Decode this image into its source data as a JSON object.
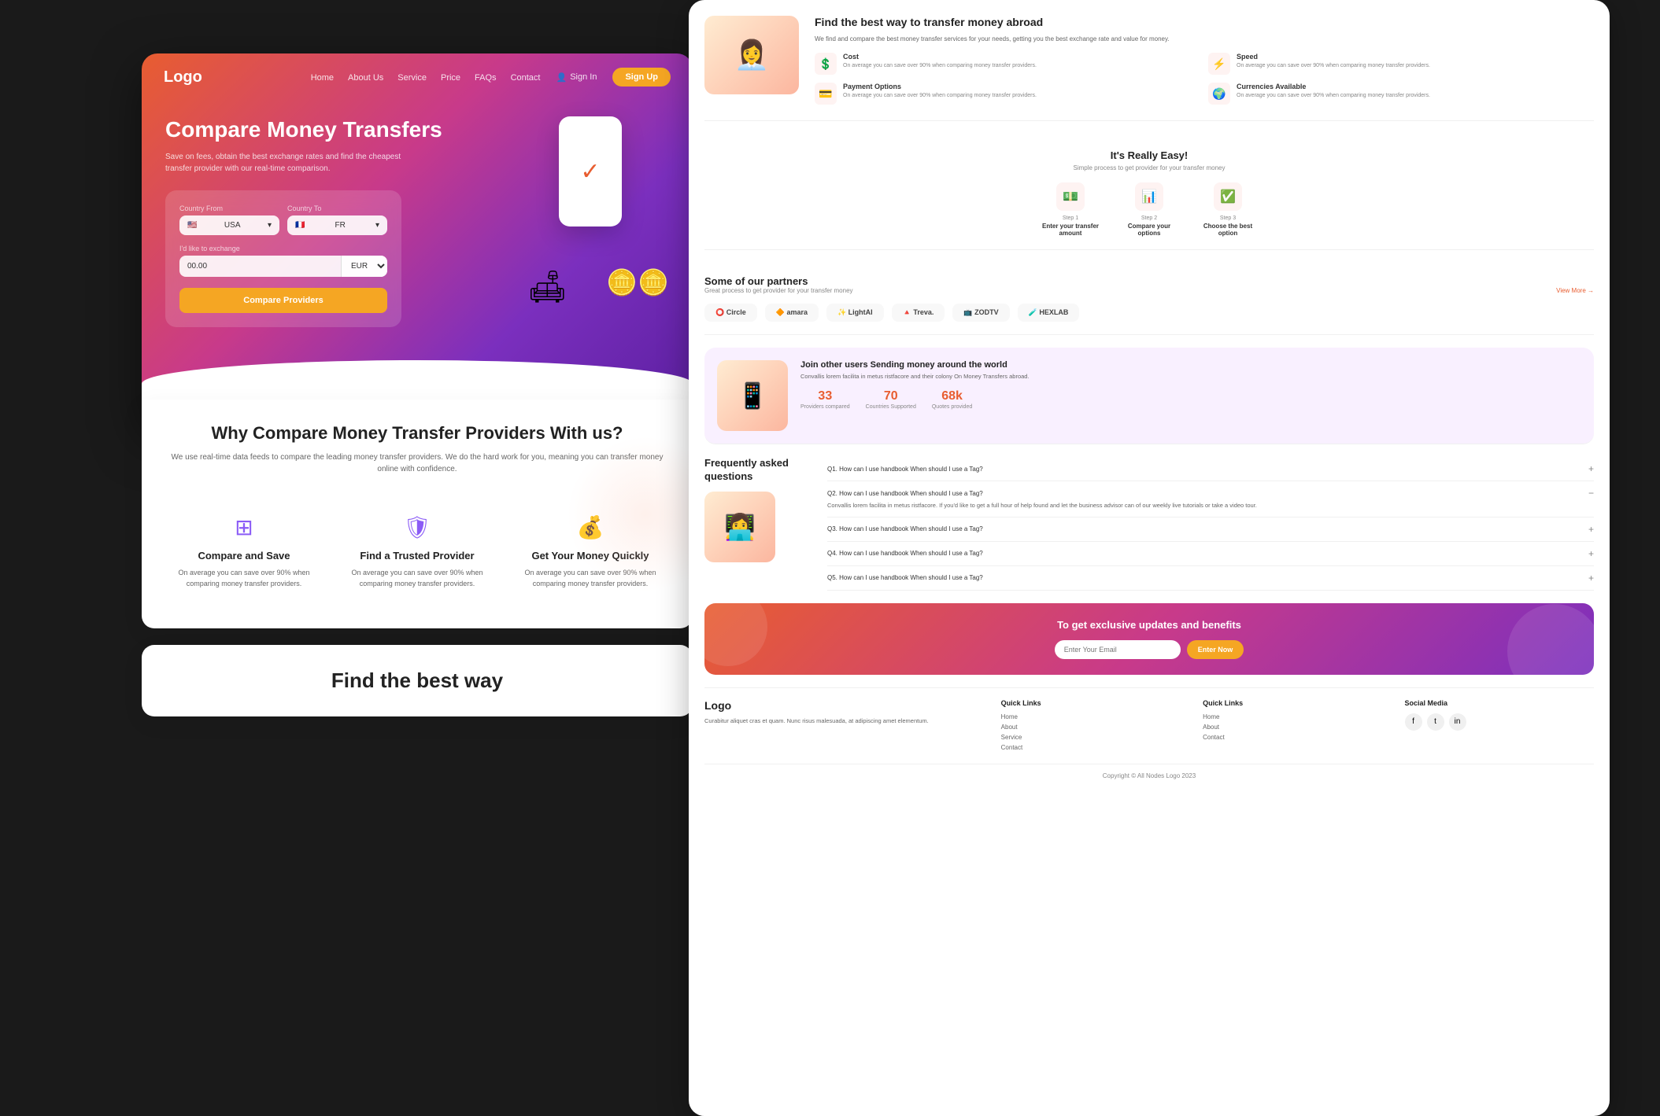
{
  "nav": {
    "logo": "Logo",
    "links": [
      "Home",
      "About Us",
      "Service",
      "Price",
      "FAQs",
      "Contact"
    ],
    "signin": "Sign In",
    "signup": "Sign Up"
  },
  "hero": {
    "title": "Compare Money Transfers",
    "subtitle": "Save on fees, obtain the best exchange rates and find the cheapest transfer provider with our real-time comparison.",
    "form": {
      "countryFromLabel": "Country From",
      "countryToLabel": "Country To",
      "countryFromValue": "USA",
      "countryToValue": "FR",
      "exchangeLabel": "I'd like to exchange",
      "exchangeValue": "00.00",
      "currency": "EUR",
      "buttonLabel": "Compare Providers"
    }
  },
  "why": {
    "title": "Why Compare Money Transfer Providers With us?",
    "subtitle": "We use real-time data feeds to compare the leading money transfer providers. We do the hard work for you, meaning you can transfer money online with confidence.",
    "features": [
      {
        "icon": "⊞",
        "title": "Compare and Save",
        "desc": "On average you can save over 90% when comparing money transfer providers."
      },
      {
        "icon": "🛡",
        "title": "Find a Trusted Provider",
        "desc": "On average you can save over 90% when comparing money transfer providers."
      },
      {
        "icon": "💰",
        "title": "Get Your Money Quickly",
        "desc": "On average you can save over 90% when comparing money transfer providers."
      }
    ]
  },
  "find": {
    "title": "Find the best way"
  },
  "right": {
    "hero": {
      "title": "Find the best way to transfer money abroad",
      "desc": "We find and compare the best money transfer services for your needs, getting you the best exchange rate and value for money.",
      "features": [
        {
          "icon": "💲",
          "label": "Cost",
          "desc": "On average you can save over 90% when comparing money transfer providers."
        },
        {
          "icon": "⚡",
          "label": "Speed",
          "desc": "On average you can save over 90% when comparing money transfer providers."
        },
        {
          "icon": "💳",
          "label": "Payment Options",
          "desc": "On average you can save over 90% when comparing money transfer providers."
        },
        {
          "icon": "🌍",
          "label": "Currencies Available",
          "desc": "On average you can save over 90% when comparing money transfer providers."
        }
      ]
    },
    "easy": {
      "title": "It's Really Easy!",
      "subtitle": "Simple process to get provider for your transfer money",
      "steps": [
        {
          "num": "Step 1",
          "label": "Enter your transfer amount",
          "icon": "💵"
        },
        {
          "num": "Step 2",
          "label": "Compare your options",
          "icon": "📊"
        },
        {
          "num": "Step 3",
          "label": "Choose the best option",
          "icon": "✅"
        }
      ]
    },
    "partners": {
      "title": "Some of our partners",
      "subtitle": "Great process to get provider for your transfer money",
      "more": "View More →",
      "logos": [
        "⭕ Circle",
        "🔶 amara",
        "✨ LightAI",
        "🔺 Treva.",
        "📺 ZODTV",
        "🧪 HEXLAB"
      ]
    },
    "worldwide": {
      "title": "Join other users Sending money around the world",
      "subtitle": "Convallis lorem facilita in metus ristfacore and their colony On Money Transfers abroad.",
      "stats": [
        {
          "value": "33",
          "label": "Providers compared"
        },
        {
          "value": "70",
          "label": "Countries Supported"
        },
        {
          "value": "68k",
          "label": "Quotes provided"
        }
      ]
    },
    "faq": {
      "title": "Frequently asked questions",
      "items": [
        {
          "q": "Q1. How can I use handbook When should I use a Tag?",
          "a": ""
        },
        {
          "q": "Q2. How can I use handbook When should I use a Tag?",
          "a": "Convallis lorem facilita in metus ristfacore. If you'd like to get a full hour of help found and let the business advisor can of our weekly live tutorials or take a video tour."
        },
        {
          "q": "Q3. How can I use handbook When should I use a Tag?",
          "a": ""
        },
        {
          "q": "Q4. How can I use handbook When should I use a Tag?",
          "a": ""
        },
        {
          "q": "Q5. How can I use handbook When should I use a Tag?",
          "a": ""
        }
      ]
    },
    "newsletter": {
      "title": "To get exclusive updates and benefits",
      "placeholder": "Enter Your Email",
      "button": "Enter Now"
    },
    "footer": {
      "logo": "Logo",
      "desc": "Curabitur aliquet cras et quam. Nunc risus malesuada, at adipiscing amet elementum.",
      "cols": [
        {
          "title": "Quick Links",
          "links": [
            "Home",
            "About",
            "Service",
            "Contact"
          ]
        },
        {
          "title": "Quick Links",
          "links": [
            "Home",
            "About",
            "Contact"
          ]
        },
        {
          "title": "Social Media",
          "links": []
        }
      ],
      "social": [
        "f",
        "t",
        "in"
      ],
      "copyright": "Copyright © All Nodes Logo 2023"
    }
  },
  "compare_save": {
    "title": "Compare and Save",
    "desc": "On average you can save over 90% when comparing money transfer providers."
  },
  "find_best": {
    "title": "Find the best way to transfer money abroad"
  },
  "faq_section": {
    "title": "Frequently asked questions"
  },
  "exclusive": {
    "title": "To get exclusive updates and benefits"
  }
}
